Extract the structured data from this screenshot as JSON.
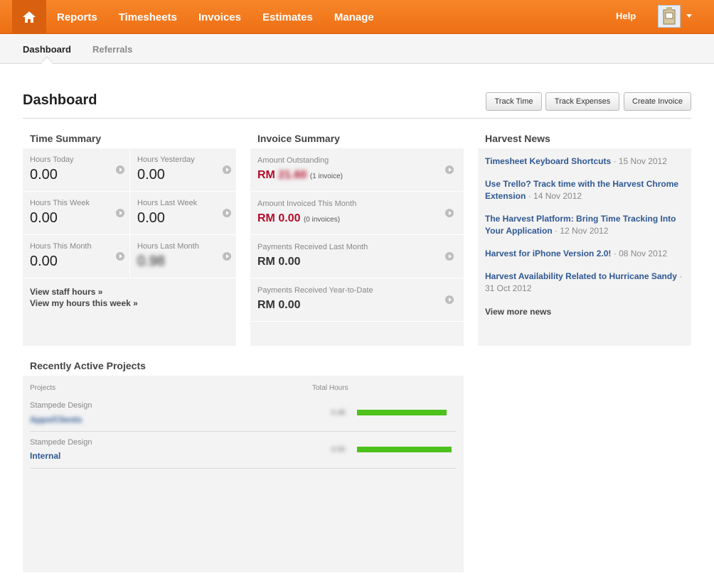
{
  "nav": {
    "items": [
      "Reports",
      "Timesheets",
      "Invoices",
      "Estimates",
      "Manage"
    ],
    "help": "Help"
  },
  "subnav": {
    "dashboard": "Dashboard",
    "referrals": "Referrals"
  },
  "header": {
    "title": "Dashboard",
    "buttons": {
      "track_time": "Track Time",
      "track_expenses": "Track Expenses",
      "create_invoice": "Create Invoice"
    }
  },
  "time_summary": {
    "heading": "Time Summary",
    "cells": [
      {
        "label": "Hours Today",
        "value": "0.00"
      },
      {
        "label": "Hours Yesterday",
        "value": "0.00"
      },
      {
        "label": "Hours This Week",
        "value": "0.00"
      },
      {
        "label": "Hours Last Week",
        "value": "0.00"
      },
      {
        "label": "Hours This Month",
        "value": "0.00"
      },
      {
        "label": "Hours Last Month",
        "value": "0.98"
      }
    ],
    "links": [
      "View staff hours »",
      "View my hours this week »"
    ]
  },
  "invoice_summary": {
    "heading": "Invoice Summary",
    "rows": [
      {
        "label": "Amount Outstanding",
        "currency": "RM",
        "amount": "21.60",
        "note": "(1 invoice)"
      },
      {
        "label": "Amount Invoiced This Month",
        "currency": "RM",
        "amount": "0.00",
        "note": "(0 invoices)"
      },
      {
        "label": "Payments Received Last Month",
        "currency": "RM",
        "amount": "0.00"
      },
      {
        "label": "Payments Received Year-to-Date",
        "currency": "RM",
        "amount": "0.00"
      }
    ]
  },
  "news": {
    "heading": "Harvest News",
    "items": [
      {
        "title": "Timesheet Keyboard Shortcuts",
        "date": "15 Nov 2012"
      },
      {
        "title": "Use Trello? Track time with the Harvest Chrome Extension",
        "date": "14 Nov 2012"
      },
      {
        "title": "The Harvest Platform: Bring Time Tracking Into Your Application",
        "date": "12 Nov 2012"
      },
      {
        "title": "Harvest for iPhone Version 2.0!",
        "date": "08 Nov 2012"
      },
      {
        "title": "Harvest Availability Related to Hurricane Sandy",
        "date": "31 Oct 2012"
      }
    ],
    "more": "View more news"
  },
  "projects": {
    "heading": "Recently Active Projects",
    "col_projects": "Projects",
    "col_hours": "Total Hours",
    "rows": [
      {
        "client": "Stampede Design",
        "name": "Apps/Clients",
        "hours": "0.48",
        "fill": 0.9
      },
      {
        "client": "Stampede Design",
        "name": "Internal",
        "hours": "0.50",
        "fill": 0.95
      }
    ]
  },
  "colors": {
    "accent": "#f07a1f",
    "link": "#2f5892",
    "money_red": "#b30c2b",
    "bar_green": "#4dc11c"
  }
}
